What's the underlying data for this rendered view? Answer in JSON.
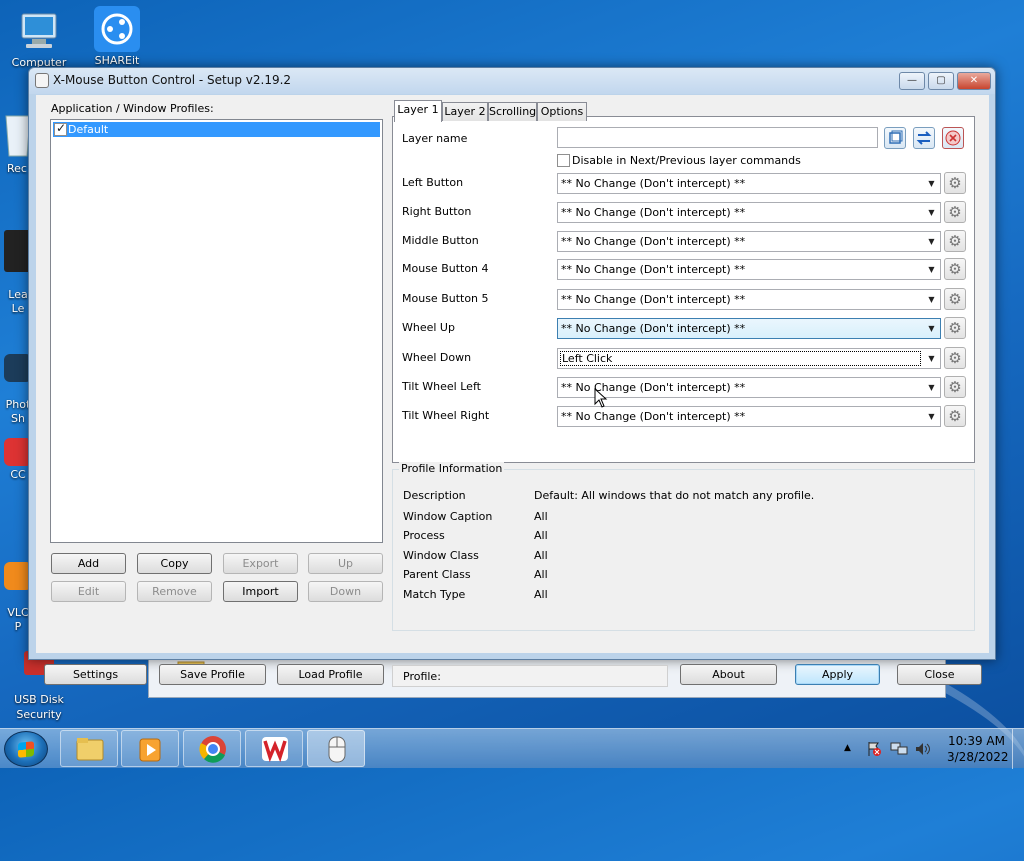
{
  "desktop": {
    "icons": [
      {
        "label": "Computer"
      },
      {
        "label": "SHAREit"
      },
      {
        "label": "Rec"
      },
      {
        "label": "Lea\nLe"
      },
      {
        "label": "Phot\nSh"
      },
      {
        "label": "CC"
      },
      {
        "label": "VLC\nP"
      },
      {
        "label": "USB Disk\nSecurity"
      }
    ]
  },
  "window": {
    "title": "X-Mouse Button Control - Setup v2.19.2",
    "controls": {
      "minimize": "—",
      "maximize": "▢",
      "close": "✕"
    }
  },
  "profiles": {
    "heading": "Application / Window Profiles:",
    "items": [
      {
        "label": "Default",
        "checked": true
      }
    ],
    "buttons": {
      "add": "Add",
      "copy": "Copy",
      "export": "Export",
      "up": "Up",
      "edit": "Edit",
      "remove": "Remove",
      "import": "Import",
      "down": "Down"
    }
  },
  "tabs": [
    "Layer 1",
    "Layer 2",
    "Scrolling",
    "Options"
  ],
  "layer": {
    "name_label": "Layer name",
    "name_value": "",
    "disable_label": "Disable in Next/Previous layer commands",
    "disable_checked": false,
    "rows": [
      {
        "label": "Left Button",
        "value": "** No Change (Don't intercept) **"
      },
      {
        "label": "Right Button",
        "value": "** No Change (Don't intercept) **"
      },
      {
        "label": "Middle Button",
        "value": "** No Change (Don't intercept) **"
      },
      {
        "label": "Mouse Button 4",
        "value": "** No Change (Don't intercept) **"
      },
      {
        "label": "Mouse Button 5",
        "value": "** No Change (Don't intercept) **"
      },
      {
        "label": "Wheel Up",
        "value": "** No Change (Don't intercept) **"
      },
      {
        "label": "Wheel Down",
        "value": "Left Click"
      },
      {
        "label": "Tilt Wheel Left",
        "value": "** No Change (Don't intercept) **"
      },
      {
        "label": "Tilt Wheel Right",
        "value": "** No Change (Don't intercept) **"
      }
    ],
    "gear_icon": "⚙"
  },
  "profile_info": {
    "legend": "Profile Information",
    "fields": [
      {
        "label": "Description",
        "value": "Default: All windows that do not match any profile."
      },
      {
        "label": "Window Caption",
        "value": "All"
      },
      {
        "label": "Process",
        "value": "All"
      },
      {
        "label": "Window Class",
        "value": "All"
      },
      {
        "label": "Parent Class",
        "value": "All"
      },
      {
        "label": "Match Type",
        "value": "All"
      }
    ]
  },
  "footer": {
    "settings": "Settings",
    "save_profile": "Save Profile",
    "load_profile": "Load Profile",
    "profile_label": "Profile:",
    "about": "About",
    "apply": "Apply",
    "close": "Close"
  },
  "taskbar": {
    "time": "10:39 AM",
    "date": "3/28/2022",
    "tray_arrow": "▲"
  }
}
